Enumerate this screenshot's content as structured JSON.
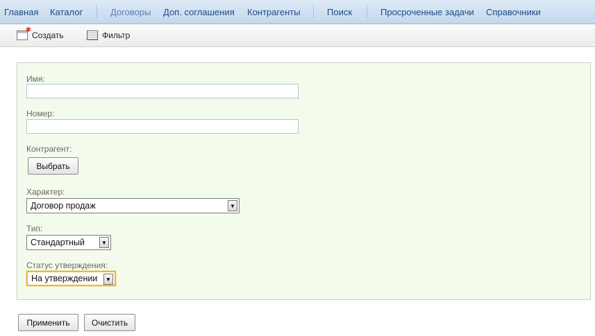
{
  "nav": {
    "items": [
      {
        "label": "Главная"
      },
      {
        "label": "Каталог"
      },
      {
        "label": "Договоры",
        "active": true
      },
      {
        "label": "Доп. соглашения"
      },
      {
        "label": "Контрагенты"
      },
      {
        "label": "Поиск"
      },
      {
        "label": "Просроченные задачи"
      },
      {
        "label": "Справочники"
      }
    ]
  },
  "toolbar": {
    "create_label": "Создать",
    "filter_label": "Фильтр"
  },
  "form": {
    "name_label": "Имя:",
    "name_value": "",
    "number_label": "Номер:",
    "number_value": "",
    "counterparty_label": "Контрагент:",
    "select_button": "Выбрать",
    "character_label": "Характер:",
    "character_value": "Договор продаж",
    "type_label": "Тип:",
    "type_value": "Стандартный",
    "status_label": "Статус утверждения:",
    "status_value": "На утверждении"
  },
  "actions": {
    "apply": "Применить",
    "clear": "Очистить"
  },
  "colors": {
    "nav_bg": "#c3d7ee",
    "nav_text": "#1f4a83",
    "panel_bg": "#f3fbed",
    "focus_border": "#e2b84a"
  }
}
